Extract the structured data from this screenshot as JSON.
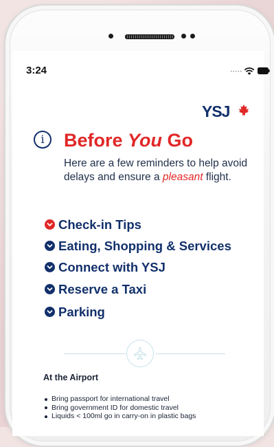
{
  "status_bar": {
    "time": "3:24"
  },
  "brand": {
    "logo_text": "YSJ",
    "primary_color": "#12306b",
    "accent_color": "#e12727"
  },
  "header": {
    "title_prefix": "Before ",
    "title_emphasis": "You",
    "title_suffix": " Go",
    "intro_prefix": "Here are a few reminders to help avoid delays and ensure a ",
    "intro_emphasis": "pleasant",
    "intro_suffix": " flight."
  },
  "menu": {
    "items": [
      {
        "label": "Check-in Tips",
        "icon": "chevron-down-circle-icon",
        "active": true
      },
      {
        "label": "Eating, Shopping & Services",
        "icon": "chevron-down-circle-icon",
        "active": false
      },
      {
        "label": "Connect with YSJ",
        "icon": "chevron-down-circle-icon",
        "active": false
      },
      {
        "label": "Reserve a Taxi",
        "icon": "chevron-down-circle-icon",
        "active": false
      },
      {
        "label": "Parking",
        "icon": "chevron-down-circle-icon",
        "active": false
      }
    ]
  },
  "section": {
    "title": "At the Airport",
    "bullets": [
      "Bring passport for international travel",
      "Bring government ID for domestic travel",
      "Liquids < 100ml go in carry-on in plastic bags"
    ]
  }
}
